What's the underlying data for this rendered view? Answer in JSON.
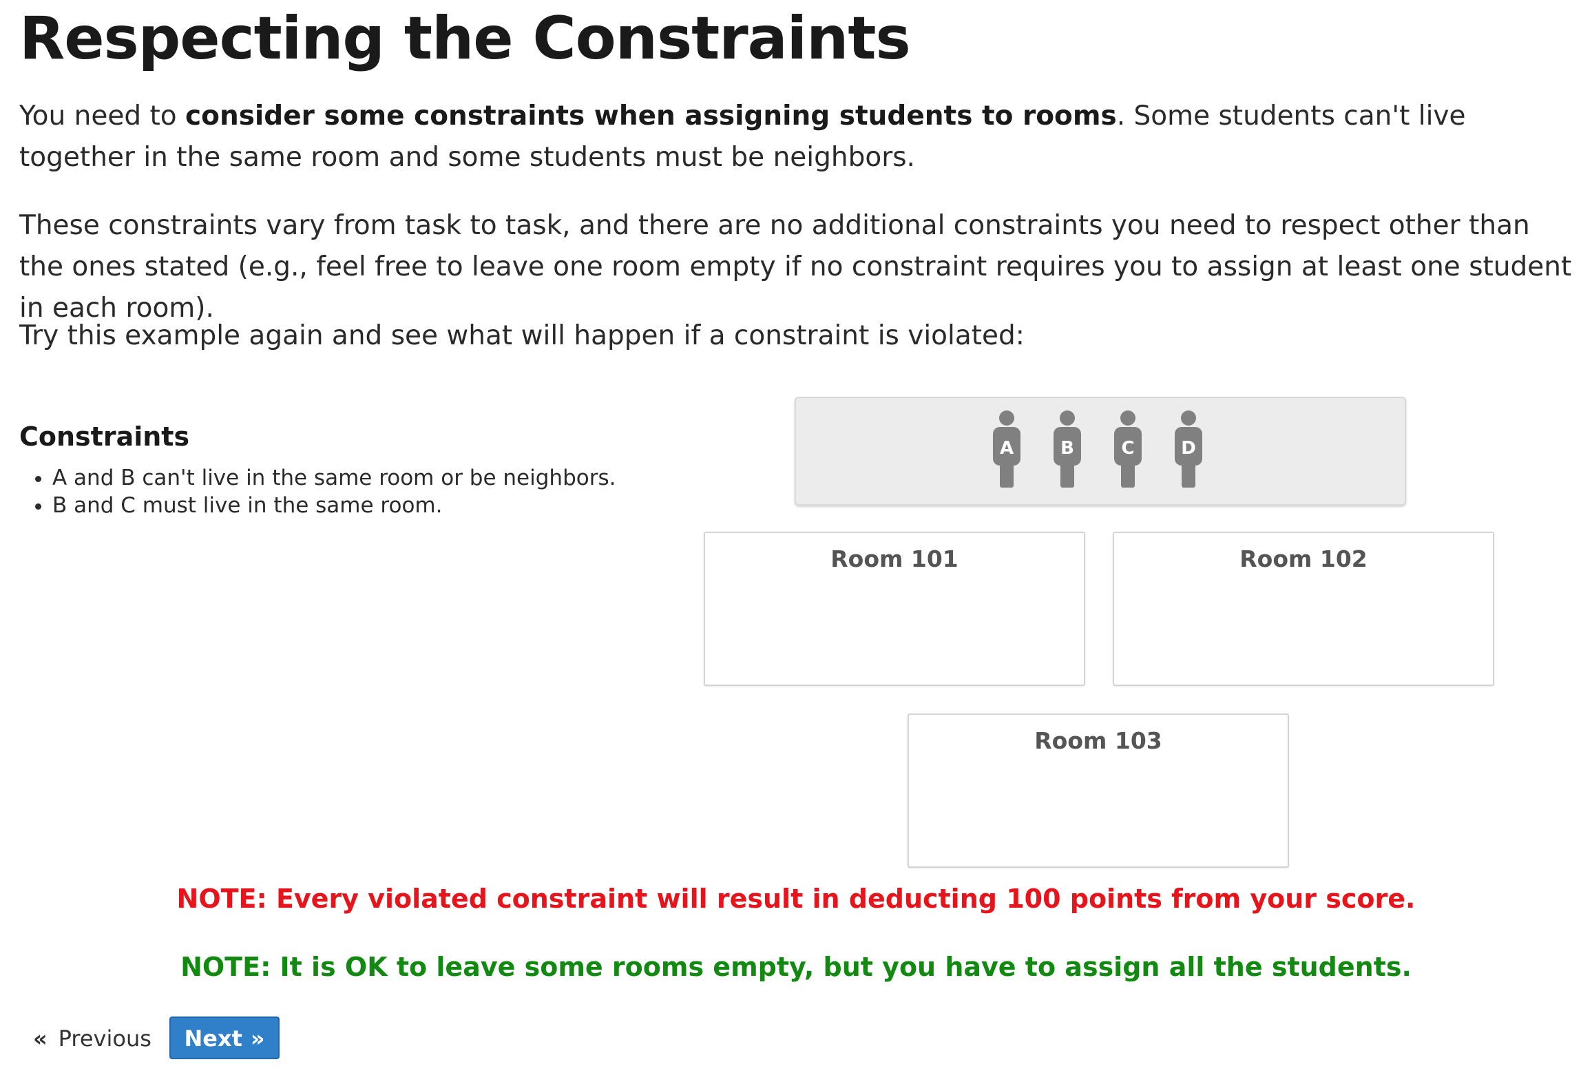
{
  "header": {
    "title": "Respecting the Constraints"
  },
  "intro": {
    "p1_pre": "You need to ",
    "p1_bold": "consider some constraints when assigning students to rooms",
    "p1_post": ". Some students can't live together in the same room and some students must be neighbors.",
    "p2": "These constraints vary from task to task, and there are no additional constraints you need to respect other than the ones stated (e.g., feel free to leave one room empty if no constraint requires you to assign at least one student in each room).",
    "p3": "Try this example again and see what will happen if a constraint is violated:"
  },
  "constraints": {
    "heading": "Constraints",
    "items": [
      "A and B can't live in the same room or be neighbors.",
      "B and C must live in the same room."
    ]
  },
  "students": [
    {
      "label": "A"
    },
    {
      "label": "B"
    },
    {
      "label": "C"
    },
    {
      "label": "D"
    }
  ],
  "rooms": [
    {
      "label": "Room 101"
    },
    {
      "label": "Room 102"
    },
    {
      "label": "Room 103"
    }
  ],
  "notes": {
    "penalty": "NOTE: Every violated constraint will result in deducting 100 points from your score.",
    "empty_ok": "NOTE: It is OK to leave some rooms empty, but you have to assign all the students."
  },
  "nav": {
    "previous_label": "Previous",
    "next_label": "Next"
  },
  "colors": {
    "penalty_note": "#e8141b",
    "ok_note": "#128a12",
    "student_figure": "#808080",
    "next_button": "#2f7fc9"
  },
  "icons": {
    "previous": "double-chevron-left-icon",
    "next": "double-chevron-right-icon",
    "student": "person-icon"
  }
}
